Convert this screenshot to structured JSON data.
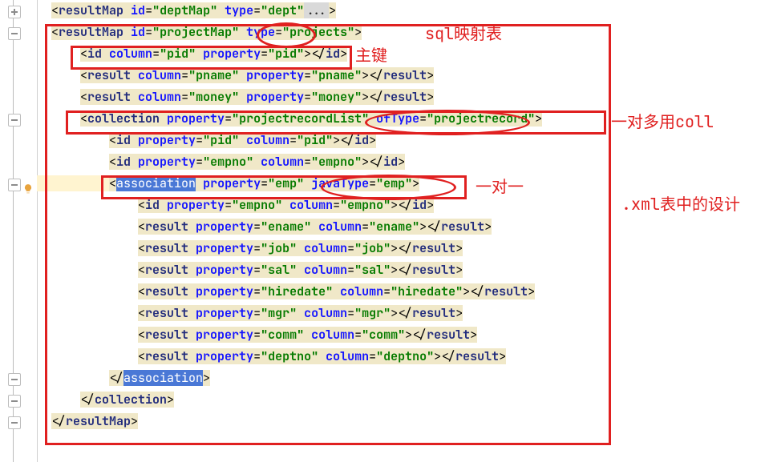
{
  "gutter": {
    "lightbulb_title": "suggestions"
  },
  "annotations": {
    "sql_table": "sql映射表",
    "pk": "主键",
    "one_to_many": "一对多用coll",
    "one_to_one": "一对一",
    "xml_design": ".xml表中的设计"
  },
  "src": {
    "l0": "  <resultMap id=\"deptMap\" type=\"dept\"...>",
    "l1": "  <resultMap id=\"projectMap\" type=\"projects\">",
    "l2": "      <id column=\"pid\" property=\"pid\"></id>",
    "l3": "      <result column=\"pname\" property=\"pname\"></result>",
    "l4": "      <result column=\"money\" property=\"money\"></result>",
    "l5": "      <collection property=\"projectrecordList\" ofType=\"projectrecord\">",
    "l6": "          <id property=\"pid\" column=\"pid\"></id>",
    "l7": "          <id property=\"empno\" column=\"empno\"></id>",
    "l8": "          <association property=\"emp\" javaType=\"emp\">",
    "l9": "              <id property=\"empno\" column=\"empno\"></id>",
    "l10": "              <result property=\"ename\" column=\"ename\"></result>",
    "l11": "              <result property=\"job\" column=\"job\"></result>",
    "l12": "              <result property=\"sal\" column=\"sal\"></result>",
    "l13": "              <result property=\"hiredate\" column=\"hiredate\"></result>",
    "l14": "              <result property=\"mgr\" column=\"mgr\"></result>",
    "l15": "              <result property=\"comm\" column=\"comm\"></result>",
    "l16": "              <result property=\"deptno\" column=\"deptno\"></result>",
    "l17": "          </association>",
    "l18": "      </collection>",
    "l19": "  </resultMap>"
  },
  "chart_data": {
    "type": "table",
    "title": "MyBatis resultMap definitions",
    "resultMaps": [
      {
        "id": "deptMap",
        "type": "dept",
        "collapsed": true
      },
      {
        "id": "projectMap",
        "type": "projects",
        "id_columns": [
          {
            "column": "pid",
            "property": "pid"
          }
        ],
        "results": [
          {
            "column": "pname",
            "property": "pname"
          },
          {
            "column": "money",
            "property": "money"
          }
        ],
        "collection": {
          "property": "projectrecordList",
          "ofType": "projectrecord",
          "id_columns": [
            {
              "property": "pid",
              "column": "pid"
            },
            {
              "property": "empno",
              "column": "empno"
            }
          ],
          "association": {
            "property": "emp",
            "javaType": "emp",
            "id_columns": [
              {
                "property": "empno",
                "column": "empno"
              }
            ],
            "results": [
              {
                "property": "ename",
                "column": "ename"
              },
              {
                "property": "job",
                "column": "job"
              },
              {
                "property": "sal",
                "column": "sal"
              },
              {
                "property": "hiredate",
                "column": "hiredate"
              },
              {
                "property": "mgr",
                "column": "mgr"
              },
              {
                "property": "comm",
                "column": "comm"
              },
              {
                "property": "deptno",
                "column": "deptno"
              }
            ]
          }
        }
      }
    ],
    "annotations_cn": {
      "sql映射表": "sql mapping table (the type attr)",
      "主键": "primary key (the <id> element)",
      "一对多用coll": "one-to-many uses <collection>",
      "一对一": "one-to-one (<association>)",
      ".xml表中的设计": "design in the .xml file"
    }
  }
}
